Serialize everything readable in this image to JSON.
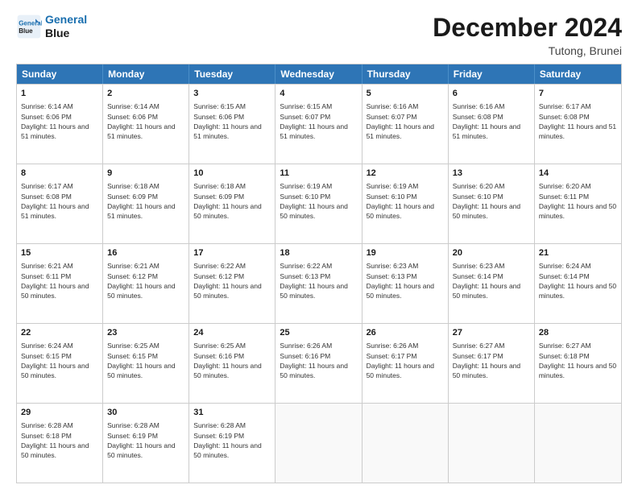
{
  "logo": {
    "line1": "General",
    "line2": "Blue"
  },
  "title": "December 2024",
  "subtitle": "Tutong, Brunei",
  "header": {
    "days": [
      "Sunday",
      "Monday",
      "Tuesday",
      "Wednesday",
      "Thursday",
      "Friday",
      "Saturday"
    ]
  },
  "weeks": [
    [
      {
        "day": 1,
        "sunrise": "6:14 AM",
        "sunset": "6:06 PM",
        "daylight": "11 hours and 51 minutes."
      },
      {
        "day": 2,
        "sunrise": "6:14 AM",
        "sunset": "6:06 PM",
        "daylight": "11 hours and 51 minutes."
      },
      {
        "day": 3,
        "sunrise": "6:15 AM",
        "sunset": "6:06 PM",
        "daylight": "11 hours and 51 minutes."
      },
      {
        "day": 4,
        "sunrise": "6:15 AM",
        "sunset": "6:07 PM",
        "daylight": "11 hours and 51 minutes."
      },
      {
        "day": 5,
        "sunrise": "6:16 AM",
        "sunset": "6:07 PM",
        "daylight": "11 hours and 51 minutes."
      },
      {
        "day": 6,
        "sunrise": "6:16 AM",
        "sunset": "6:08 PM",
        "daylight": "11 hours and 51 minutes."
      },
      {
        "day": 7,
        "sunrise": "6:17 AM",
        "sunset": "6:08 PM",
        "daylight": "11 hours and 51 minutes."
      }
    ],
    [
      {
        "day": 8,
        "sunrise": "6:17 AM",
        "sunset": "6:08 PM",
        "daylight": "11 hours and 51 minutes."
      },
      {
        "day": 9,
        "sunrise": "6:18 AM",
        "sunset": "6:09 PM",
        "daylight": "11 hours and 51 minutes."
      },
      {
        "day": 10,
        "sunrise": "6:18 AM",
        "sunset": "6:09 PM",
        "daylight": "11 hours and 50 minutes."
      },
      {
        "day": 11,
        "sunrise": "6:19 AM",
        "sunset": "6:10 PM",
        "daylight": "11 hours and 50 minutes."
      },
      {
        "day": 12,
        "sunrise": "6:19 AM",
        "sunset": "6:10 PM",
        "daylight": "11 hours and 50 minutes."
      },
      {
        "day": 13,
        "sunrise": "6:20 AM",
        "sunset": "6:10 PM",
        "daylight": "11 hours and 50 minutes."
      },
      {
        "day": 14,
        "sunrise": "6:20 AM",
        "sunset": "6:11 PM",
        "daylight": "11 hours and 50 minutes."
      }
    ],
    [
      {
        "day": 15,
        "sunrise": "6:21 AM",
        "sunset": "6:11 PM",
        "daylight": "11 hours and 50 minutes."
      },
      {
        "day": 16,
        "sunrise": "6:21 AM",
        "sunset": "6:12 PM",
        "daylight": "11 hours and 50 minutes."
      },
      {
        "day": 17,
        "sunrise": "6:22 AM",
        "sunset": "6:12 PM",
        "daylight": "11 hours and 50 minutes."
      },
      {
        "day": 18,
        "sunrise": "6:22 AM",
        "sunset": "6:13 PM",
        "daylight": "11 hours and 50 minutes."
      },
      {
        "day": 19,
        "sunrise": "6:23 AM",
        "sunset": "6:13 PM",
        "daylight": "11 hours and 50 minutes."
      },
      {
        "day": 20,
        "sunrise": "6:23 AM",
        "sunset": "6:14 PM",
        "daylight": "11 hours and 50 minutes."
      },
      {
        "day": 21,
        "sunrise": "6:24 AM",
        "sunset": "6:14 PM",
        "daylight": "11 hours and 50 minutes."
      }
    ],
    [
      {
        "day": 22,
        "sunrise": "6:24 AM",
        "sunset": "6:15 PM",
        "daylight": "11 hours and 50 minutes."
      },
      {
        "day": 23,
        "sunrise": "6:25 AM",
        "sunset": "6:15 PM",
        "daylight": "11 hours and 50 minutes."
      },
      {
        "day": 24,
        "sunrise": "6:25 AM",
        "sunset": "6:16 PM",
        "daylight": "11 hours and 50 minutes."
      },
      {
        "day": 25,
        "sunrise": "6:26 AM",
        "sunset": "6:16 PM",
        "daylight": "11 hours and 50 minutes."
      },
      {
        "day": 26,
        "sunrise": "6:26 AM",
        "sunset": "6:17 PM",
        "daylight": "11 hours and 50 minutes."
      },
      {
        "day": 27,
        "sunrise": "6:27 AM",
        "sunset": "6:17 PM",
        "daylight": "11 hours and 50 minutes."
      },
      {
        "day": 28,
        "sunrise": "6:27 AM",
        "sunset": "6:18 PM",
        "daylight": "11 hours and 50 minutes."
      }
    ],
    [
      {
        "day": 29,
        "sunrise": "6:28 AM",
        "sunset": "6:18 PM",
        "daylight": "11 hours and 50 minutes."
      },
      {
        "day": 30,
        "sunrise": "6:28 AM",
        "sunset": "6:19 PM",
        "daylight": "11 hours and 50 minutes."
      },
      {
        "day": 31,
        "sunrise": "6:28 AM",
        "sunset": "6:19 PM",
        "daylight": "11 hours and 50 minutes."
      },
      null,
      null,
      null,
      null
    ]
  ]
}
